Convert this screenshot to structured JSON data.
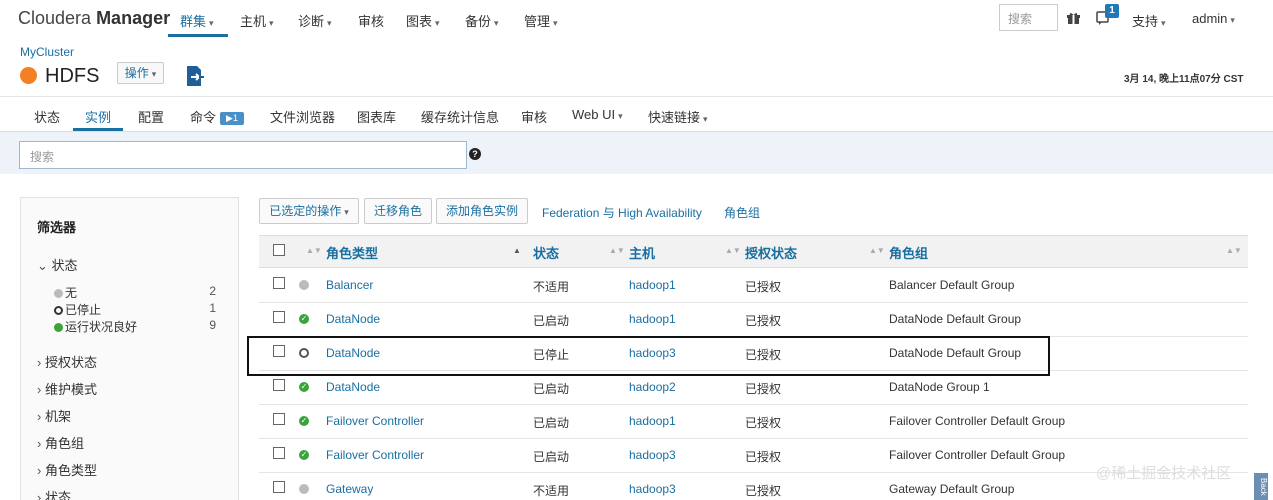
{
  "topnav": {
    "brand_light": "Cloudera",
    "brand_bold": "Manager",
    "items": [
      {
        "label": "群集",
        "active": true
      },
      {
        "label": "主机"
      },
      {
        "label": "诊断"
      },
      {
        "label": "审核"
      },
      {
        "label": "图表"
      },
      {
        "label": "备份"
      },
      {
        "label": "管理"
      }
    ],
    "search_placeholder": "搜索",
    "notif_count": "1",
    "support": "支持",
    "user": "admin"
  },
  "header": {
    "cluster": "MyCluster",
    "service": "HDFS",
    "actions": "操作",
    "timestamp": "3月 14, 晚上11点07分 CST"
  },
  "subnav": {
    "items": [
      "状态",
      "实例",
      "配置",
      "命令",
      "文件浏览器",
      "图表库",
      "缓存统计信息",
      "审核",
      "Web UI",
      "快速链接"
    ],
    "active": "实例"
  },
  "search": {
    "placeholder": "搜索"
  },
  "filter": {
    "title": "筛选器",
    "status_head": "状态",
    "status_items": [
      {
        "label": "无",
        "count": "2"
      },
      {
        "label": "已停止",
        "count": "1"
      },
      {
        "label": "运行状况良好",
        "count": "9"
      }
    ],
    "sections": [
      "授权状态",
      "维护模式",
      "机架",
      "角色组",
      "角色类型",
      "状态"
    ]
  },
  "actions": {
    "selected": "已选定的操作",
    "migrate": "迁移角色",
    "add": "添加角色实例",
    "federation": "Federation 与 High Availability",
    "role_groups": "角色组"
  },
  "table": {
    "headers": [
      "角色类型",
      "状态",
      "主机",
      "授权状态",
      "角色组"
    ],
    "rows": [
      {
        "status_icon": "none",
        "role": "Balancer",
        "state": "不适用",
        "host": "hadoop1",
        "auth": "已授权",
        "group": "Balancer Default Group"
      },
      {
        "status_icon": "good",
        "role": "DataNode",
        "state": "已启动",
        "host": "hadoop1",
        "auth": "已授权",
        "group": "DataNode Default Group"
      },
      {
        "status_icon": "stopped",
        "role": "DataNode",
        "state": "已停止",
        "host": "hadoop3",
        "auth": "已授权",
        "group": "DataNode Default Group"
      },
      {
        "status_icon": "good",
        "role": "DataNode",
        "state": "已启动",
        "host": "hadoop2",
        "auth": "已授权",
        "group": "DataNode Group 1"
      },
      {
        "status_icon": "good",
        "role": "Failover Controller",
        "state": "已启动",
        "host": "hadoop1",
        "auth": "已授权",
        "group": "Failover Controller Default Group"
      },
      {
        "status_icon": "good",
        "role": "Failover Controller",
        "state": "已启动",
        "host": "hadoop3",
        "auth": "已授权",
        "group": "Failover Controller Default Group"
      },
      {
        "status_icon": "none",
        "role": "Gateway",
        "state": "不适用",
        "host": "hadoop3",
        "auth": "已授权",
        "group": "Gateway Default Group"
      }
    ]
  },
  "watermark": "@稀土掘金技术社区",
  "scroll_tab": "Back",
  "colors": {
    "accent": "#1a6fa1",
    "service_status": "#f48024",
    "good": "#3ca33c"
  }
}
